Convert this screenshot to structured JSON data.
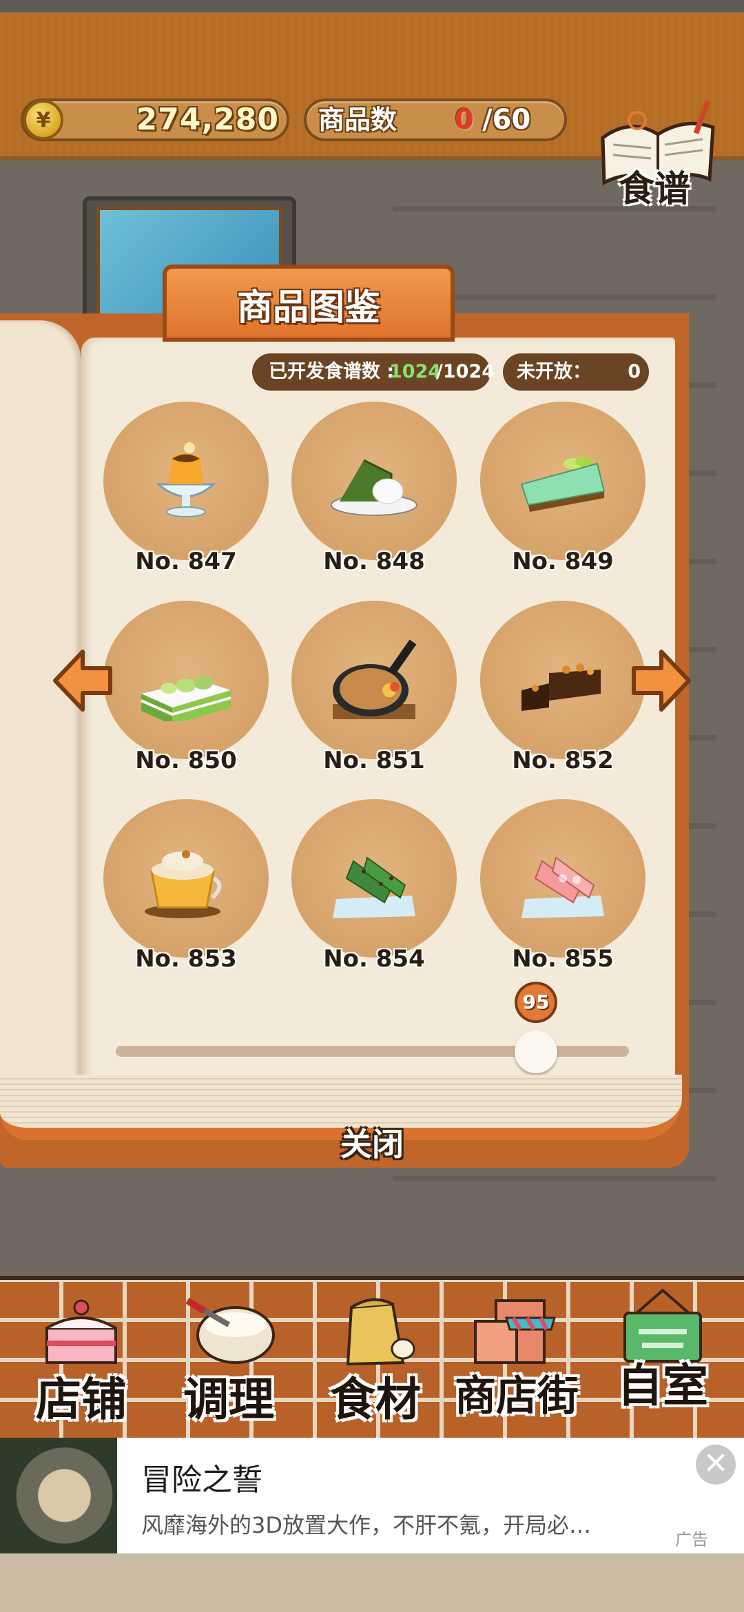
{
  "header": {
    "currency_symbol": "¥",
    "money": "274,280",
    "goods_label": "商品数",
    "goods_count": "0",
    "goods_max": "/60",
    "recipe_button_label": "食谱"
  },
  "dialog": {
    "title": "商品图鉴",
    "unlocked_label": "已开发食谱数 :",
    "unlocked_value": "1024",
    "unlocked_total": "/1024",
    "locked_label": "未开放：",
    "locked_value": "0",
    "items": [
      {
        "number": "No. 847",
        "food": "pudding-parfait"
      },
      {
        "number": "No. 848",
        "food": "matcha-cake-slice"
      },
      {
        "number": "No. 849",
        "food": "lime-pie-slice"
      },
      {
        "number": "No. 850",
        "food": "matcha-layer-cake"
      },
      {
        "number": "No. 851",
        "food": "skillet-pancake"
      },
      {
        "number": "No. 852",
        "food": "chocolate-pound-cake"
      },
      {
        "number": "No. 853",
        "food": "orange-drink-cup"
      },
      {
        "number": "No. 854",
        "food": "matcha-dango-skewers"
      },
      {
        "number": "No. 855",
        "food": "pink-dango-skewers"
      }
    ],
    "page_slider_value": "95",
    "close_label": "关闭"
  },
  "nav": [
    {
      "label": "店铺",
      "icon": "cake-shop-icon"
    },
    {
      "label": "调理",
      "icon": "mixing-bowl-icon"
    },
    {
      "label": "食材",
      "icon": "ingredient-sack-icon"
    },
    {
      "label": "商店街",
      "icon": "shopping-street-icon"
    },
    {
      "label": "自室",
      "icon": "staff-only-sign-icon"
    }
  ],
  "ad": {
    "title": "冒险之誓",
    "description": "风靡海外的3D放置大作，不肝不氪，开局必…",
    "tag": "广告",
    "close_glyph": "✕"
  },
  "colors": {
    "accent_orange": "#e0742d",
    "wood_brown": "#7a4b1c",
    "highlight_green": "#8be06f",
    "warning_red": "#e23a2a"
  }
}
